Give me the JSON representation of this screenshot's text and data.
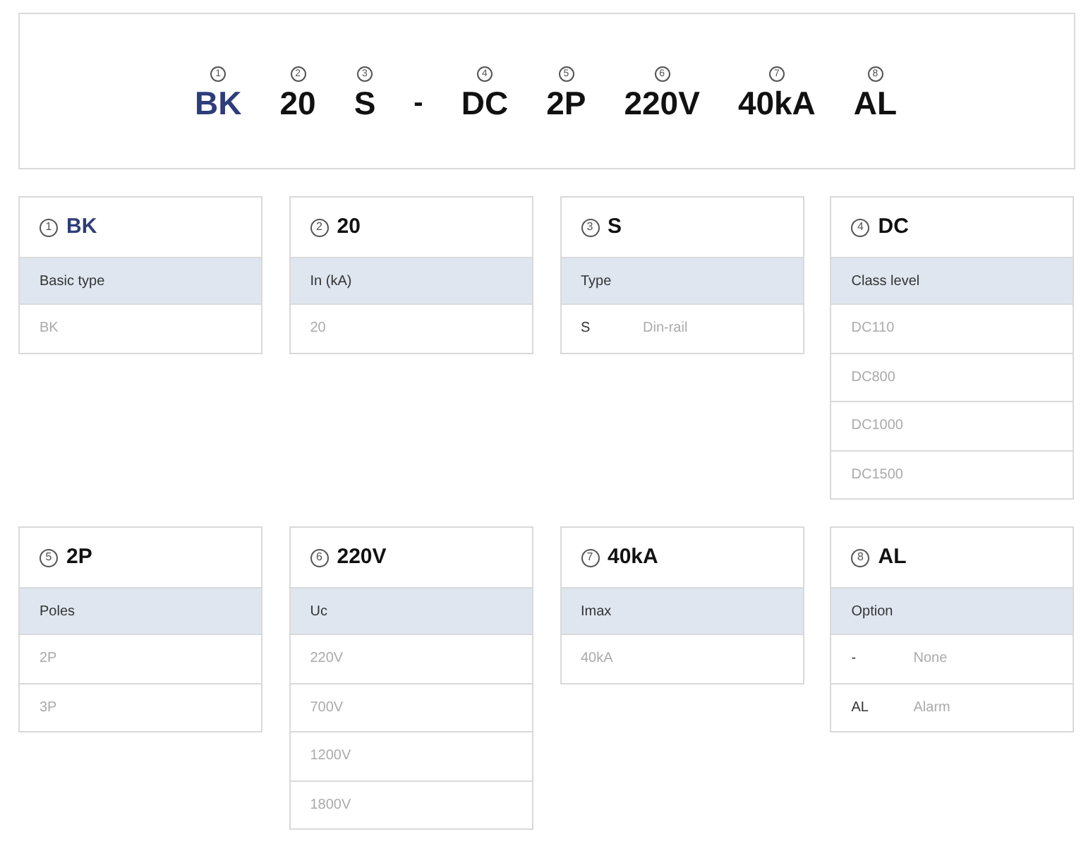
{
  "code": [
    {
      "kind": "code",
      "number": "1",
      "text": "BK",
      "highlighted": true
    },
    {
      "kind": "code",
      "number": "2",
      "text": "20",
      "highlighted": false
    },
    {
      "kind": "code",
      "number": "3",
      "text": "S",
      "highlighted": false
    },
    {
      "kind": "separator",
      "text": "-"
    },
    {
      "kind": "code",
      "number": "4",
      "text": "DC",
      "highlighted": false
    },
    {
      "kind": "code",
      "number": "5",
      "text": "2P",
      "highlighted": false
    },
    {
      "kind": "code",
      "number": "6",
      "text": "220V",
      "highlighted": false
    },
    {
      "kind": "code",
      "number": "7",
      "text": "40kA",
      "highlighted": false
    },
    {
      "kind": "code",
      "number": "8",
      "text": "AL",
      "highlighted": false
    }
  ],
  "cards": [
    {
      "number": "1",
      "title": "BK",
      "highlighted": true,
      "label": "Basic type",
      "options": [
        {
          "kind": "value",
          "code": "BK"
        }
      ]
    },
    {
      "number": "2",
      "title": "20",
      "highlighted": false,
      "label": "In (kA)",
      "options": [
        {
          "kind": "value",
          "code": "20"
        }
      ]
    },
    {
      "number": "3",
      "title": "S",
      "highlighted": false,
      "label": "Type",
      "options": [
        {
          "kind": "described",
          "code": "S",
          "description": "Din-rail"
        }
      ]
    },
    {
      "number": "4",
      "title": "DC",
      "highlighted": false,
      "label": "Class level",
      "options": [
        {
          "kind": "value",
          "code": "DC110"
        },
        {
          "kind": "value",
          "code": "DC800"
        },
        {
          "kind": "value",
          "code": "DC1000"
        },
        {
          "kind": "value",
          "code": "DC1500"
        }
      ]
    },
    {
      "number": "5",
      "title": "2P",
      "highlighted": false,
      "label": "Poles",
      "options": [
        {
          "kind": "value",
          "code": "2P"
        },
        {
          "kind": "value",
          "code": "3P"
        }
      ]
    },
    {
      "number": "6",
      "title": "220V",
      "highlighted": false,
      "label": "Uc",
      "options": [
        {
          "kind": "value",
          "code": "220V"
        },
        {
          "kind": "value",
          "code": "700V"
        },
        {
          "kind": "value",
          "code": "1200V"
        },
        {
          "kind": "value",
          "code": "1800V"
        }
      ]
    },
    {
      "number": "7",
      "title": "40kA",
      "highlighted": false,
      "label": "Imax",
      "options": [
        {
          "kind": "value",
          "code": "40kA"
        }
      ]
    },
    {
      "number": "8",
      "title": "AL",
      "highlighted": false,
      "label": "Option",
      "options": [
        {
          "kind": "described",
          "code": "-",
          "description": "None"
        },
        {
          "kind": "described",
          "code": "AL",
          "description": "Alarm"
        }
      ]
    }
  ]
}
